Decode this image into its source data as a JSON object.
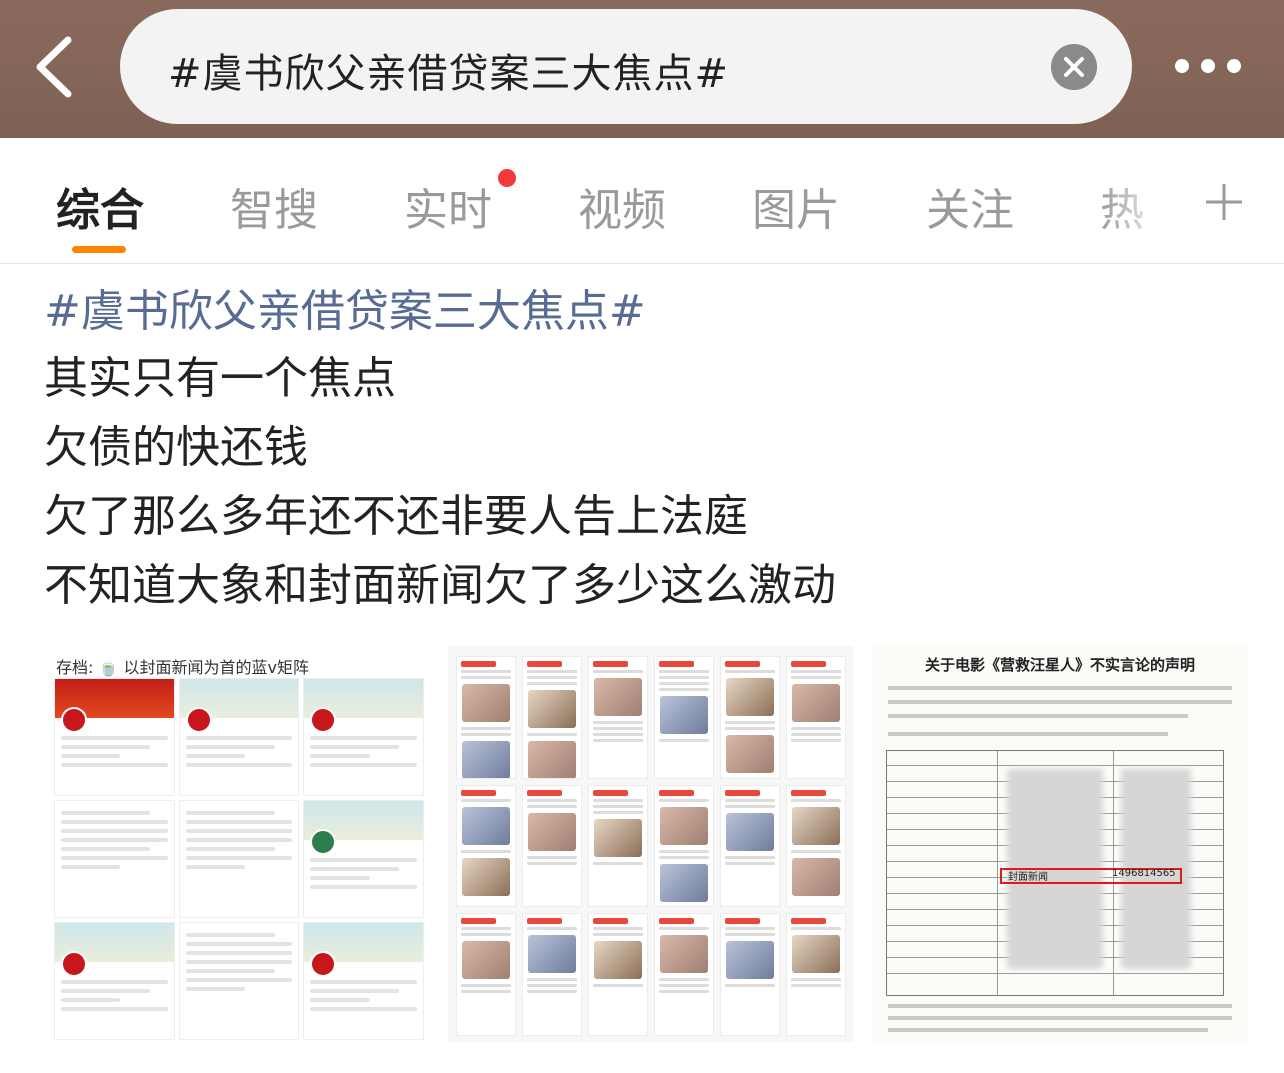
{
  "header": {
    "search_query": "#虞书欣父亲借贷案三大焦点#"
  },
  "tabs": [
    {
      "label": "综合",
      "active": true
    },
    {
      "label": "智搜",
      "active": false
    },
    {
      "label": "实时",
      "active": false,
      "badge": "red-dot"
    },
    {
      "label": "视频",
      "active": false
    },
    {
      "label": "图片",
      "active": false
    },
    {
      "label": "关注",
      "active": false
    },
    {
      "label": "热",
      "active": false
    }
  ],
  "post": {
    "hashtag": "#虞书欣父亲借贷案三大焦点#",
    "lines": [
      "其实只有一个焦点",
      "欠债的快还钱",
      "欠了那么多年还不还非要人告上法庭",
      "不知道大象和封面新闻欠了多少这么激动"
    ]
  },
  "images": {
    "image1": {
      "caption_prefix": "存档:",
      "caption": "以封面新闻为首的蓝v矩阵"
    },
    "image3": {
      "title": "关于电影《营救汪星人》不实言论的声明",
      "highlight_name": "封面新闻",
      "highlight_id": "1496814565"
    }
  },
  "colors": {
    "header_bg": "#8a6a5c",
    "accent_orange": "#ff8200",
    "hashtag_blue": "#576b95",
    "badge_red": "#f23a3a"
  }
}
